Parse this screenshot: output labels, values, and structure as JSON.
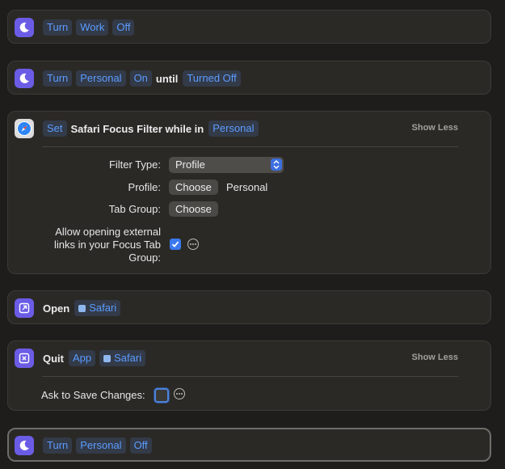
{
  "actions": {
    "turn_work_off": {
      "turn": "Turn",
      "focus": "Work",
      "state": "Off",
      "icon": "moon-icon"
    },
    "turn_personal_on": {
      "turn": "Turn",
      "focus": "Personal",
      "state": "On",
      "until": "until",
      "until_value": "Turned Off",
      "icon": "moon-icon"
    },
    "set_safari_filter": {
      "set": "Set",
      "title": "Safari Focus Filter while in",
      "focus": "Personal",
      "show_less": "Show Less",
      "icon": "safari-icon",
      "filter_type_label": "Filter Type:",
      "filter_type_value": "Profile",
      "profile_label": "Profile:",
      "profile_button": "Choose",
      "profile_value": "Personal",
      "tab_group_label": "Tab Group:",
      "tab_group_button": "Choose",
      "allow_label_1": "Allow opening external",
      "allow_label_2": "links in your Focus Tab",
      "allow_label_3": "Group:",
      "allow_checked": true
    },
    "open_safari": {
      "open": "Open",
      "app": "Safari",
      "icon": "open-arrow-icon"
    },
    "quit_app": {
      "quit": "Quit",
      "app_label": "App",
      "app": "Safari",
      "show_less": "Show Less",
      "ask_label": "Ask to Save Changes:",
      "ask_checked": false,
      "icon": "close-x-icon"
    },
    "turn_personal_off": {
      "turn": "Turn",
      "focus": "Personal",
      "state": "Off",
      "icon": "moon-icon"
    }
  },
  "colors": {
    "background": "#1f1d1b",
    "card": "#2b2926",
    "token_text": "#5b9cff",
    "action_icon": "#6b5ce6",
    "checkbox": "#3b78f0"
  }
}
